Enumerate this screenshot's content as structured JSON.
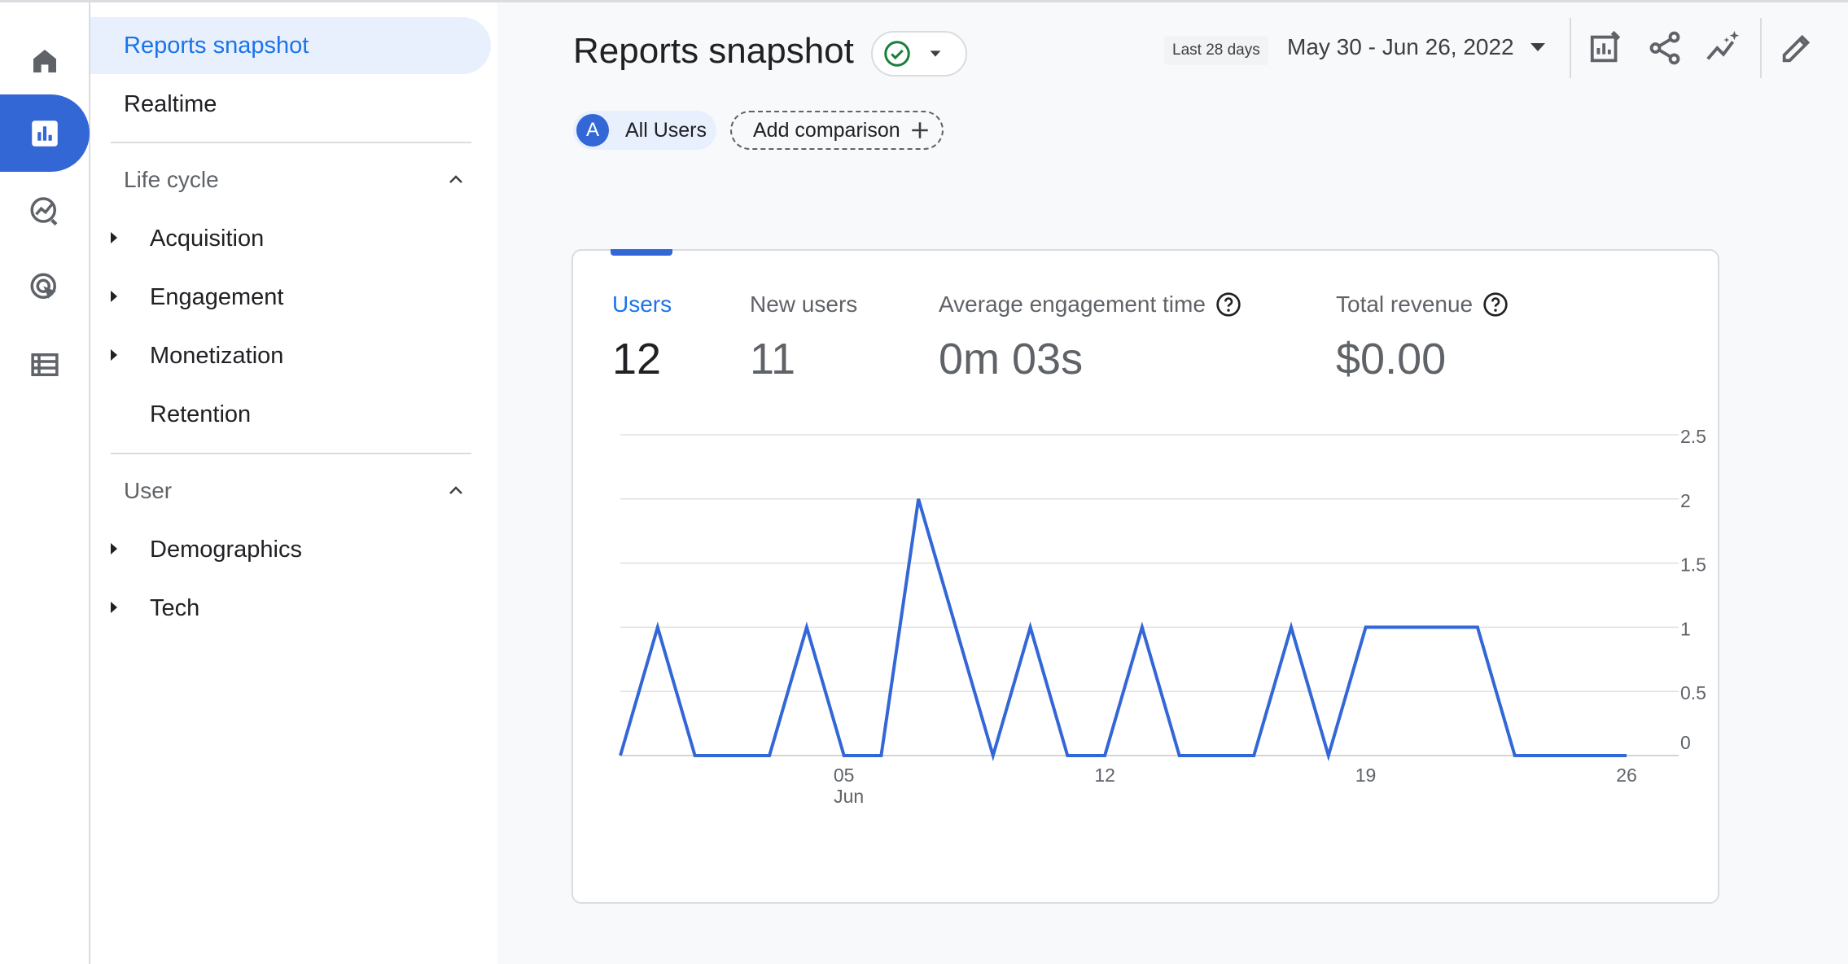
{
  "nav": {
    "selected": "Reports snapshot",
    "realtime": "Realtime",
    "sections": [
      {
        "title": "Life cycle",
        "items": [
          "Acquisition",
          "Engagement",
          "Monetization",
          "Retention"
        ]
      },
      {
        "title": "User",
        "items": [
          "Demographics",
          "Tech"
        ]
      }
    ]
  },
  "rail": {
    "icons": [
      "home-icon",
      "reports-icon",
      "explore-icon",
      "advertising-icon",
      "configure-icon"
    ],
    "active": "reports-icon"
  },
  "header": {
    "title": "Reports snapshot",
    "date_chip": "Last 28 days",
    "date_range": "May 30 - Jun 26, 2022"
  },
  "segments": {
    "avatar": "A",
    "all_users": "All Users",
    "add_comparison": "Add comparison"
  },
  "metrics": [
    {
      "label": "Users",
      "value": "12",
      "active": true,
      "help": false
    },
    {
      "label": "New users",
      "value": "11",
      "active": false,
      "help": false
    },
    {
      "label": "Average engagement time",
      "value": "0m 03s",
      "active": false,
      "help": true
    },
    {
      "label": "Total revenue",
      "value": "$0.00",
      "active": false,
      "help": true
    }
  ],
  "colors": {
    "accent": "#1a73e8",
    "series": "#3367d6",
    "nav_selected_bg": "#e8f0fe"
  },
  "chart_data": {
    "type": "line",
    "title": "",
    "xlabel": "",
    "ylabel": "",
    "series": [
      {
        "x": [
          "2022-05-30",
          "2022-05-31",
          "2022-06-01",
          "2022-06-02",
          "2022-06-03",
          "2022-06-04",
          "2022-06-05",
          "2022-06-06",
          "2022-06-07",
          "2022-06-08",
          "2022-06-09",
          "2022-06-10",
          "2022-06-11",
          "2022-06-12",
          "2022-06-13",
          "2022-06-14",
          "2022-06-15",
          "2022-06-16",
          "2022-06-17",
          "2022-06-18",
          "2022-06-19",
          "2022-06-20",
          "2022-06-21",
          "2022-06-22",
          "2022-06-23",
          "2022-06-24",
          "2022-06-25",
          "2022-06-26"
        ],
        "values": [
          0,
          1,
          0,
          0,
          0,
          1,
          0,
          0,
          2,
          1,
          0,
          1,
          0,
          0,
          1,
          0,
          0,
          0,
          1,
          0,
          1,
          1,
          1,
          1,
          0,
          0,
          0,
          0
        ]
      }
    ],
    "x_ticks": [
      {
        "date": "2022-06-05",
        "label": "05",
        "sublabel": "Jun"
      },
      {
        "date": "2022-06-12",
        "label": "12"
      },
      {
        "date": "2022-06-19",
        "label": "19"
      },
      {
        "date": "2022-06-26",
        "label": "26"
      }
    ],
    "y_ticks": [
      "2.5",
      "2",
      "1.5",
      "1",
      "0.5",
      "0"
    ],
    "ylim": [
      0,
      2.5
    ],
    "grid": true,
    "y_axis_side": "right"
  }
}
